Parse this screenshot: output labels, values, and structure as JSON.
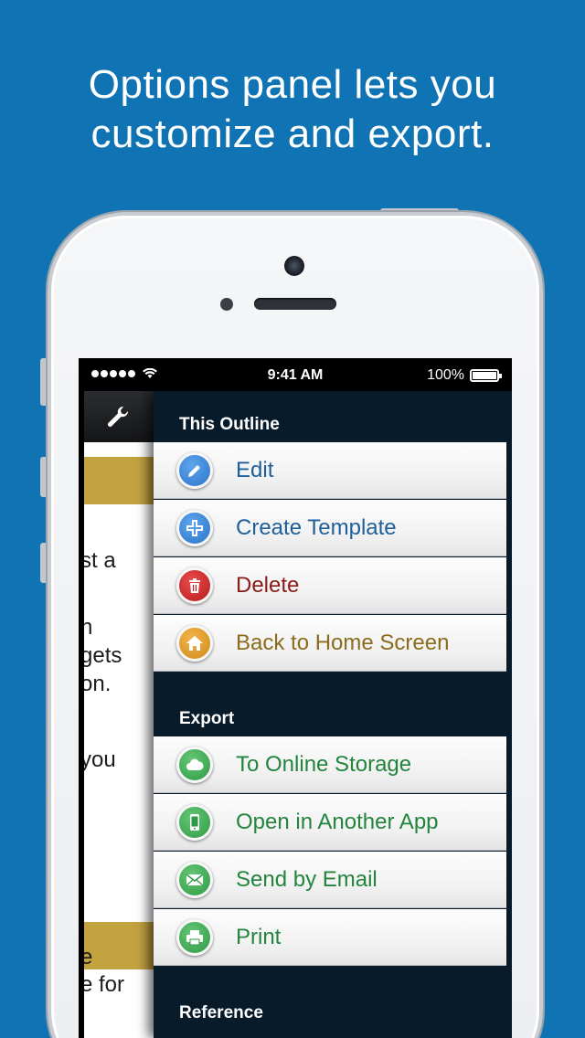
{
  "headline": {
    "line1": "Options panel lets you",
    "line2": "customize and export."
  },
  "status_bar": {
    "time": "9:41 AM",
    "battery": "100%"
  },
  "left_panel": {
    "text_lines": [
      "st a",
      "n",
      "gets",
      "on.",
      "you",
      "e",
      "e for"
    ]
  },
  "options": {
    "sections": [
      {
        "header": "This Outline",
        "items": [
          {
            "label": "Edit",
            "icon": "pencil-icon",
            "color": "#1e5f9a"
          },
          {
            "label": "Create Template",
            "icon": "plus-icon",
            "color": "#1e5f9a"
          },
          {
            "label": "Delete",
            "icon": "trash-icon",
            "color": "#8a1b17"
          },
          {
            "label": "Back to Home Screen",
            "icon": "home-icon",
            "color": "#8b6b1c"
          }
        ]
      },
      {
        "header": "Export",
        "items": [
          {
            "label": "To Online Storage",
            "icon": "cloud-icon",
            "color": "#23843d"
          },
          {
            "label": "Open in Another App",
            "icon": "phone-icon",
            "color": "#23843d"
          },
          {
            "label": "Send by Email",
            "icon": "envelope-icon",
            "color": "#23843d"
          },
          {
            "label": "Print",
            "icon": "printer-icon",
            "color": "#23843d"
          }
        ]
      },
      {
        "header": "Reference",
        "items": []
      }
    ]
  }
}
